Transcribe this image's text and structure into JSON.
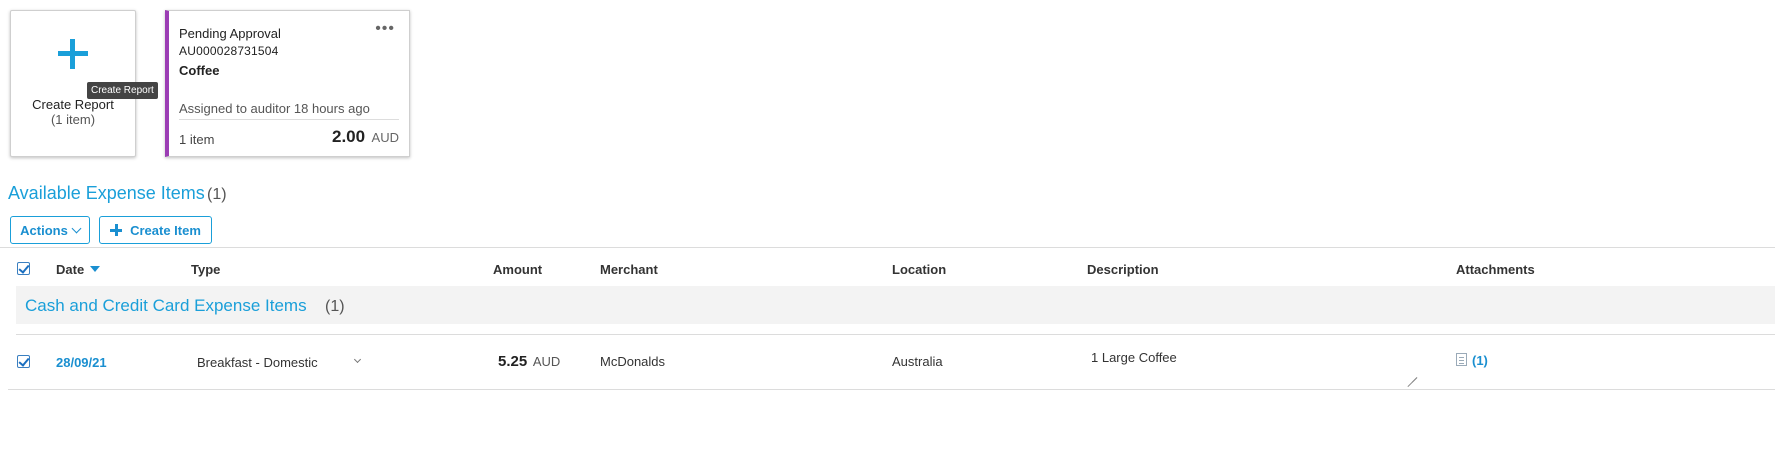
{
  "create_card": {
    "title": "Create Report",
    "subtitle": "(1 item)",
    "tooltip": "Create Report",
    "icon": "plus-icon"
  },
  "report_card": {
    "status": "Pending Approval",
    "report_id": "AU000028731504",
    "name": "Coffee",
    "menu_icon": "more-options-icon",
    "assigned": "Assigned to auditor 18 hours ago",
    "item_count": "1 item",
    "amount": "2.00",
    "currency": "AUD",
    "accent_color": "#9b3db4"
  },
  "section": {
    "title": "Available Expense Items",
    "count": "(1)"
  },
  "toolbar": {
    "actions_label": "Actions",
    "create_item_label": "Create Item"
  },
  "table": {
    "headers": {
      "date": "Date",
      "type": "Type",
      "amount": "Amount",
      "merchant": "Merchant",
      "location": "Location",
      "description": "Description",
      "attachments": "Attachments"
    },
    "sort_column": "Date",
    "sort_direction": "descending",
    "group": {
      "title": "Cash and Credit Card Expense Items",
      "count": "(1)"
    },
    "rows": [
      {
        "checked": true,
        "date": "28/09/21",
        "type": "Breakfast - Domestic",
        "amount": "5.25",
        "currency": "AUD",
        "merchant": "McDonalds",
        "location": "Australia",
        "description": "1 Large Coffee",
        "attachments": "(1)"
      }
    ]
  },
  "colors": {
    "accent": "#1a9fd9",
    "link": "#1a8fd0"
  }
}
